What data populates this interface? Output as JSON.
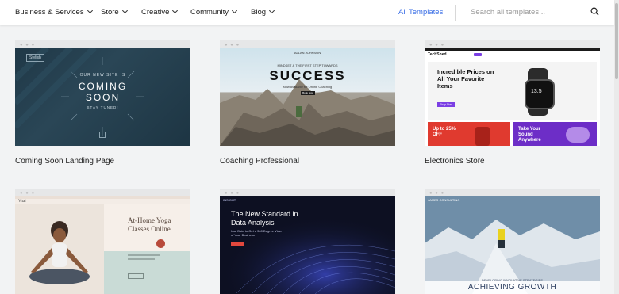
{
  "nav": {
    "items": [
      {
        "label": "Business & Services"
      },
      {
        "label": "Store"
      },
      {
        "label": "Creative"
      },
      {
        "label": "Community"
      },
      {
        "label": "Blog"
      }
    ],
    "all_templates": "All Templates",
    "search_placeholder": "Search all templates..."
  },
  "cards": [
    {
      "label": "Coming Soon Landing Page",
      "preview": {
        "brand": "Stylish",
        "line1": "OUR NEW SITE IS",
        "line2": "COMING",
        "line3": "SOON",
        "line4": "STAY TUNED!"
      }
    },
    {
      "label": "Coaching Professional",
      "preview": {
        "brand": "ALLAN JOHNSON",
        "kicker": "MINDSET & THE FIRST STEP TOWARDS",
        "headline": "SUCCESS",
        "sub": "Now Available for Online Coaching",
        "cta": "Book Now"
      }
    },
    {
      "label": "Electronics Store",
      "preview": {
        "brand": "TechShed",
        "headline": "Incredible Prices on All Your Favorite Items",
        "cta": "Shop Now",
        "tile1": "Up to 25% OFF",
        "tile2": "Take Your Sound Anywhere",
        "watch": "13:5"
      }
    },
    {
      "label": "",
      "preview": {
        "brand": "Vital",
        "headline": "At-Home Yoga Classes Online"
      }
    },
    {
      "label": "",
      "preview": {
        "brand": "INSIGHT",
        "headline": "The New Standard in Data Analysis",
        "sub": "Use Data to Get a 360 Degree View of Your Business"
      }
    },
    {
      "label": "",
      "preview": {
        "brand": "JAMES CONSULTING",
        "kicker": "DEVELOPING INNOVATIVE STRATEGIES",
        "headline": "ACHIEVING GROWTH"
      }
    }
  ]
}
